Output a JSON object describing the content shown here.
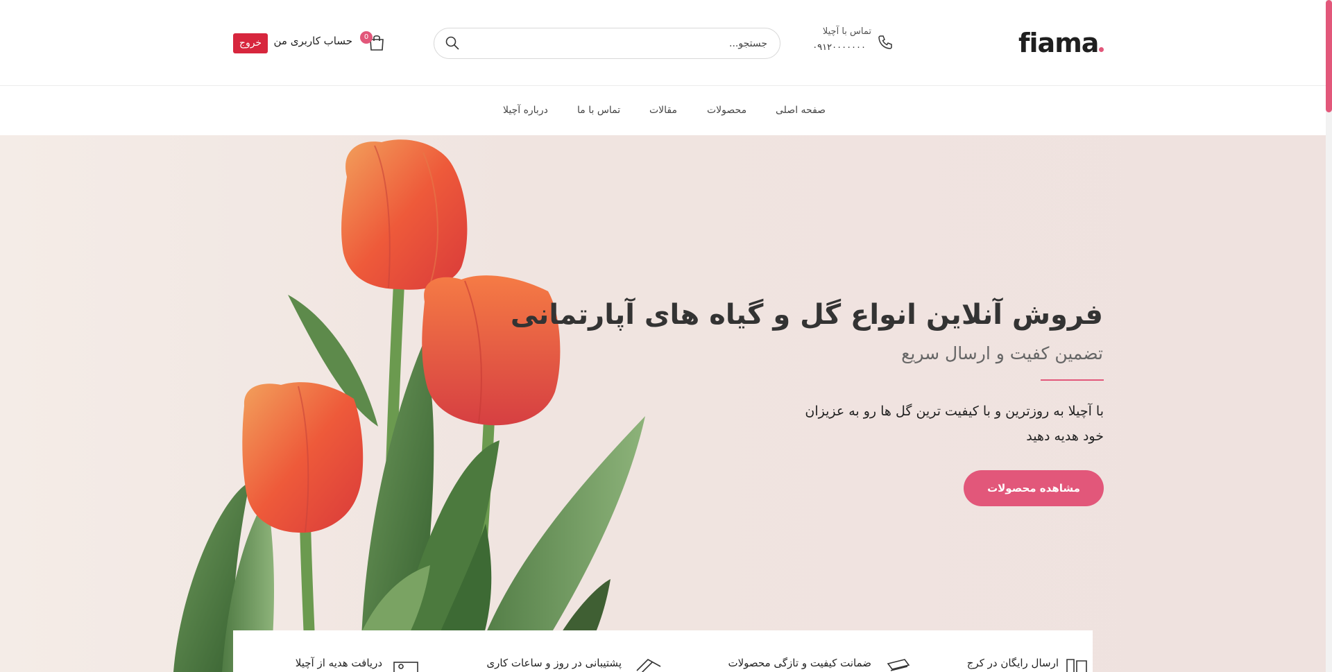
{
  "header": {
    "logo": "fiama",
    "contact_label": "تماس با آچیلا",
    "contact_number": "۰۹۱۲۰۰۰۰۰۰۰",
    "search_placeholder": "جستجو...",
    "cart_count": "0",
    "account_label": "حساب کاربری من",
    "logout_label": "خروج"
  },
  "nav": {
    "items": [
      {
        "label": "صفحه اصلی"
      },
      {
        "label": "محصولات"
      },
      {
        "label": "مقالات"
      },
      {
        "label": "تماس با ما"
      },
      {
        "label": "درباره آچیلا"
      }
    ]
  },
  "hero": {
    "title": "فروش آنلاین انواع گل و گیاه های آپارتمانی",
    "subtitle": "تضمین کفیت و ارسال سریع",
    "description_line1": "با آچیلا به روزترین و با کیفیت ترین گل ها رو به عزیزان",
    "description_line2": "خود هدیه دهید",
    "button_label": "مشاهده محصولات"
  },
  "features": [
    {
      "label": "ارسال رایگان در کرج",
      "icon": "shipping-icon"
    },
    {
      "label": "ضمانت کیفیت و تازگی محصولات",
      "icon": "quality-icon"
    },
    {
      "label": "پشتیبانی در روز و ساعات کاری",
      "icon": "support-icon"
    },
    {
      "label": "دریافت هدیه از آچیلا",
      "icon": "gift-icon"
    }
  ],
  "colors": {
    "accent": "#e2577a",
    "logout": "#d7263d",
    "hero_background": "#efe2df"
  }
}
